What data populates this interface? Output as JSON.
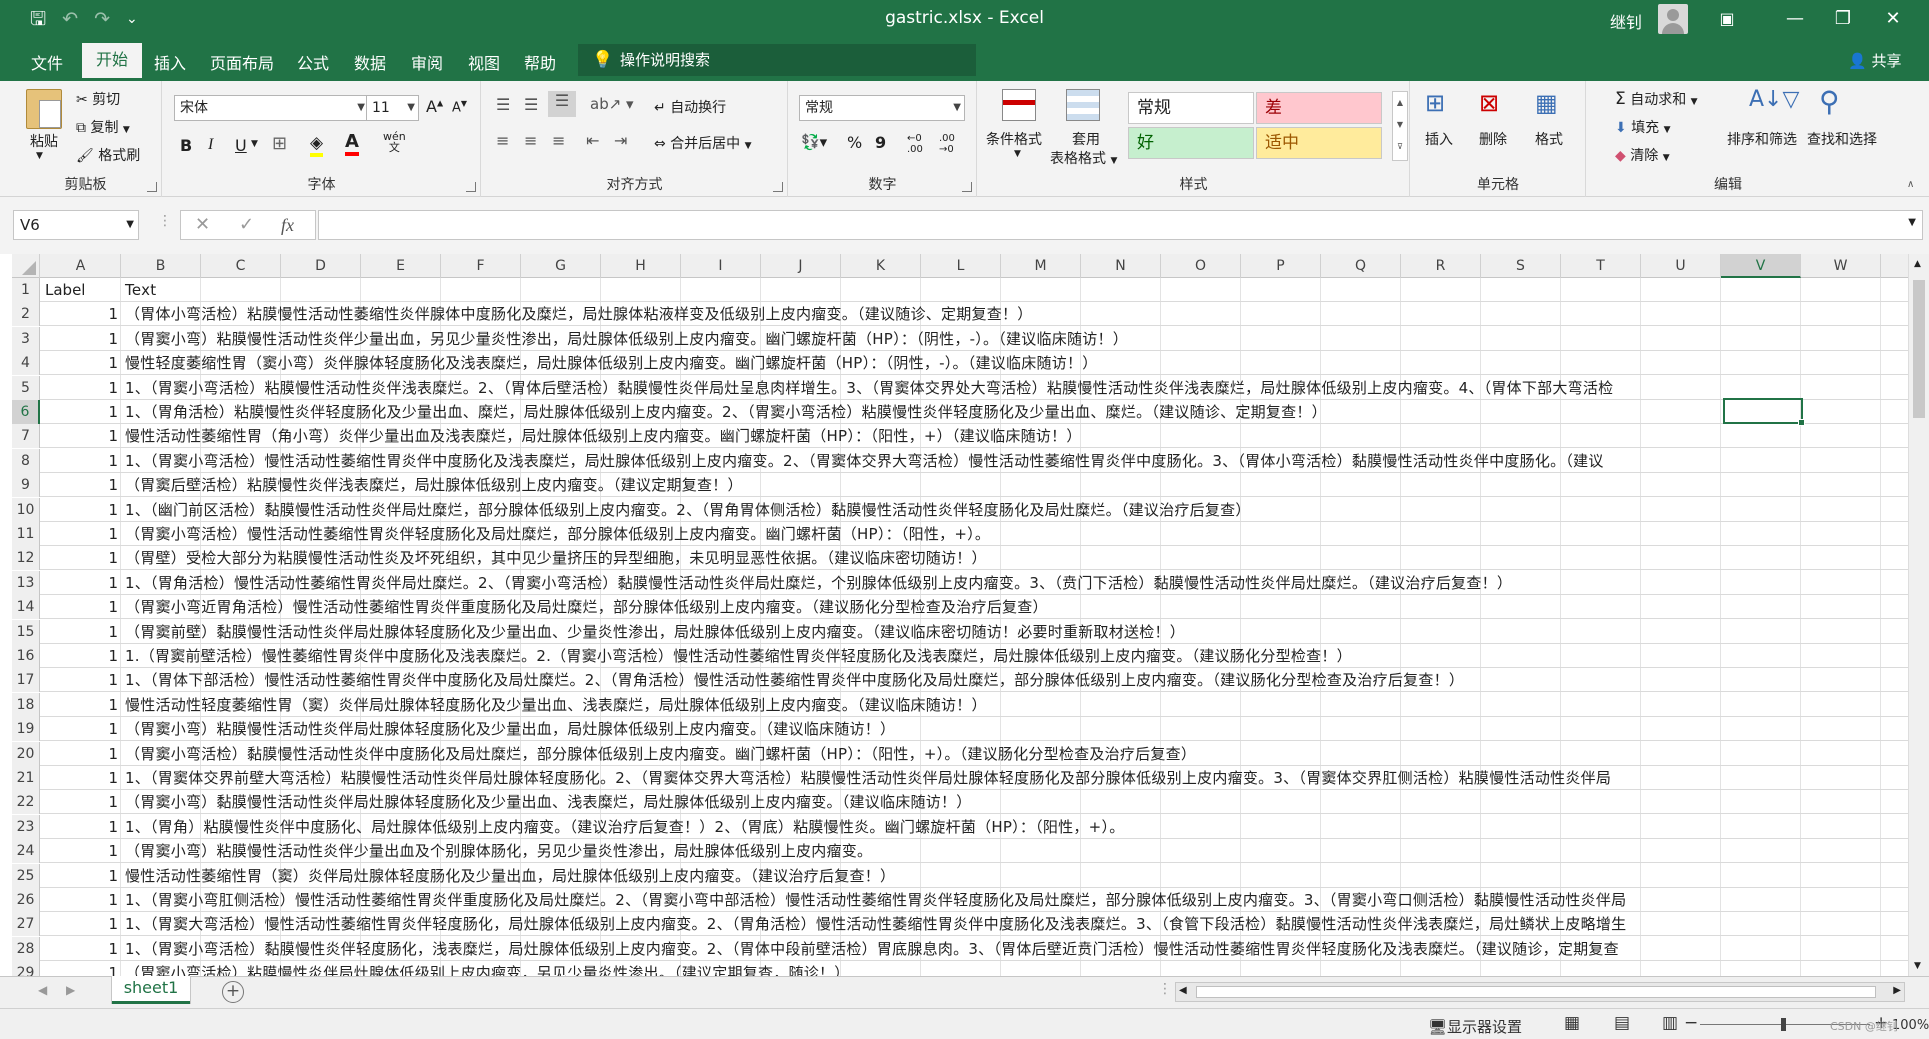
{
  "window": {
    "title": "gastric.xlsx  -  Excel",
    "user": "继钊",
    "minimize": "—",
    "maximize": "❐",
    "close": "✕",
    "ribbon_display": "▣"
  },
  "qat": {
    "save": "🖫",
    "undo": "↶",
    "redo": "↷",
    "customize": "⌄"
  },
  "menu": {
    "tabs": [
      "文件",
      "开始",
      "插入",
      "页面布局",
      "公式",
      "数据",
      "审阅",
      "视图",
      "帮助"
    ],
    "active": "开始",
    "tell_me": "操作说明搜索",
    "share": "共享"
  },
  "ribbon": {
    "clipboard": {
      "label": "剪贴板",
      "paste": "粘贴",
      "cut": "剪切",
      "copy": "复制",
      "format_painter": "格式刷"
    },
    "font": {
      "label": "字体",
      "font_name": "宋体",
      "font_size": "11",
      "bold": "B",
      "italic": "I",
      "underline": "U",
      "grow": "A",
      "shrink": "A",
      "wen": "wén"
    },
    "alignment": {
      "label": "对齐方式",
      "wrap": "自动换行",
      "merge": "合并后居中"
    },
    "number": {
      "label": "数字",
      "format": "常规",
      "percent": "%",
      "comma": "9",
      "inc": ".00",
      "dec": ".00"
    },
    "styles": {
      "label": "样式",
      "conditional": "条件格式",
      "as_table_1": "套用",
      "as_table_2": "表格格式",
      "normal": "常规",
      "bad": "差",
      "good": "好",
      "neutral": "适中"
    },
    "cells": {
      "label": "单元格",
      "insert": "插入",
      "delete": "删除",
      "format": "格式"
    },
    "editing": {
      "label": "编辑",
      "autosum": "自动求和",
      "fill": "填充",
      "clear": "清除",
      "sort_filter": "排序和筛选",
      "find_select": "查找和选择"
    },
    "colors": {
      "normal_bg": "#ffffff",
      "bad_bg": "#ffc7ce",
      "bad_fg": "#9c0006",
      "good_bg": "#c6efce",
      "good_fg": "#006100",
      "neutral_bg": "#ffeb9c",
      "neutral_fg": "#9c5700",
      "accent": "#217346"
    }
  },
  "formula_bar": {
    "name_box": "V6",
    "cancel": "✕",
    "enter": "✓",
    "fx": "fx",
    "content": ""
  },
  "columns": [
    "A",
    "B",
    "C",
    "D",
    "E",
    "F",
    "G",
    "H",
    "I",
    "J",
    "K",
    "L",
    "M",
    "N",
    "O",
    "P",
    "Q",
    "R",
    "S",
    "T",
    "U",
    "V",
    "W"
  ],
  "selected_column": "V",
  "selected_row": "6",
  "rows": [
    {
      "n": "1",
      "a": "Label",
      "b": "Text"
    },
    {
      "n": "2",
      "a": "1",
      "b": "（胃体小弯活检）粘膜慢性活动性萎缩性炎伴腺体中度肠化及糜烂，局灶腺体粘液样变及低级别上皮内瘤变。（建议随诊、定期复查！）"
    },
    {
      "n": "3",
      "a": "1",
      "b": "（胃窦小弯）粘膜慢性活动性炎伴少量出血，另见少量炎性渗出，局灶腺体低级别上皮内瘤变。幽门螺旋杆菌（HP）：（阴性，-）。（建议临床随访！）"
    },
    {
      "n": "4",
      "a": "1",
      "b": "慢性轻度萎缩性胃（窦小弯）炎伴腺体轻度肠化及浅表糜烂，局灶腺体低级别上皮内瘤变。幽门螺旋杆菌（HP）：（阴性，-）。（建议临床随访！）"
    },
    {
      "n": "5",
      "a": "1",
      "b": "1、（胃窦小弯活检）粘膜慢性活动性炎伴浅表糜烂。2、（胃体后壁活检）黏膜慢性炎伴局灶呈息肉样增生。3、（胃窦体交界处大弯活检）粘膜慢性活动性炎伴浅表糜烂，局灶腺体低级别上皮内瘤变。4、（胃体下部大弯活检"
    },
    {
      "n": "6",
      "a": "1",
      "b": "1、（胃角活检）粘膜慢性炎伴轻度肠化及少量出血、糜烂，局灶腺体低级别上皮内瘤变。2、（胃窦小弯活检）粘膜慢性炎伴轻度肠化及少量出血、糜烂。（建议随诊、定期复查！）"
    },
    {
      "n": "7",
      "a": "1",
      "b": "慢性活动性萎缩性胃（角小弯）炎伴少量出血及浅表糜烂，局灶腺体低级别上皮内瘤变。幽门螺旋杆菌（HP）：（阳性，+）（建议临床随访！）"
    },
    {
      "n": "8",
      "a": "1",
      "b": "1、（胃窦小弯活检）慢性活动性萎缩性胃炎伴中度肠化及浅表糜烂，局灶腺体低级别上皮内瘤变。2、（胃窦体交界大弯活检）慢性活动性萎缩性胃炎伴中度肠化。3、（胃体小弯活检）黏膜慢性活动性炎伴中度肠化。（建议"
    },
    {
      "n": "9",
      "a": "1",
      "b": "（胃窦后壁活检）粘膜慢性炎伴浅表糜烂，局灶腺体低级别上皮内瘤变。（建议定期复查！）"
    },
    {
      "n": "10",
      "a": "1",
      "b": "1、（幽门前区活检）黏膜慢性活动性炎伴局灶糜烂，部分腺体低级别上皮内瘤变。2、（胃角胃体侧活检）黏膜慢性活动性炎伴轻度肠化及局灶糜烂。（建议治疗后复查）"
    },
    {
      "n": "11",
      "a": "1",
      "b": "（胃窦小弯活检）慢性活动性萎缩性胃炎伴轻度肠化及局灶糜烂，部分腺体低级别上皮内瘤变。幽门螺杆菌（HP）：（阳性，+）。"
    },
    {
      "n": "12",
      "a": "1",
      "b": "（胃壁）受检大部分为粘膜慢性活动性炎及坏死组织，其中见少量挤压的异型细胞，未见明显恶性依据。（建议临床密切随访！）"
    },
    {
      "n": "13",
      "a": "1",
      "b": "1、（胃角活检）慢性活动性萎缩性胃炎伴局灶糜烂。2、（胃窦小弯活检）黏膜慢性活动性炎伴局灶糜烂，个别腺体低级别上皮内瘤变。3、（贲门下活检）黏膜慢性活动性炎伴局灶糜烂。（建议治疗后复查！）"
    },
    {
      "n": "14",
      "a": "1",
      "b": "（胃窦小弯近胃角活检）慢性活动性萎缩性胃炎伴重度肠化及局灶糜烂，部分腺体低级别上皮内瘤变。（建议肠化分型检查及治疗后复查）"
    },
    {
      "n": "15",
      "a": "1",
      "b": "（胃窦前壁）黏膜慢性活动性炎伴局灶腺体轻度肠化及少量出血、少量炎性渗出，局灶腺体低级别上皮内瘤变。（建议临床密切随访！必要时重新取材送检！）"
    },
    {
      "n": "16",
      "a": "1",
      "b": "1.（胃窦前壁活检）慢性萎缩性胃炎伴中度肠化及浅表糜烂。2.（胃窦小弯活检）慢性活动性萎缩性胃炎伴轻度肠化及浅表糜烂，局灶腺体低级别上皮内瘤变。（建议肠化分型检查！）"
    },
    {
      "n": "17",
      "a": "1",
      "b": "1、（胃体下部活检）慢性活动性萎缩性胃炎伴中度肠化及局灶糜烂。2、（胃角活检）慢性活动性萎缩性胃炎伴中度肠化及局灶糜烂，部分腺体低级别上皮内瘤变。（建议肠化分型检查及治疗后复查！）"
    },
    {
      "n": "18",
      "a": "1",
      "b": "慢性活动性轻度萎缩性胃（窦）炎伴局灶腺体轻度肠化及少量出血、浅表糜烂，局灶腺体低级别上皮内瘤变。（建议临床随访！）"
    },
    {
      "n": "19",
      "a": "1",
      "b": "（胃窦小弯）粘膜慢性活动性炎伴局灶腺体轻度肠化及少量出血，局灶腺体低级别上皮内瘤变。（建议临床随访！）"
    },
    {
      "n": "20",
      "a": "1",
      "b": "（胃窦小弯活检）黏膜慢性活动性炎伴中度肠化及局灶糜烂，部分腺体低级别上皮内瘤变。幽门螺杆菌（HP）：（阳性，+）。（建议肠化分型检查及治疗后复查）"
    },
    {
      "n": "21",
      "a": "1",
      "b": "1、（胃窦体交界前壁大弯活检）粘膜慢性活动性炎伴局灶腺体轻度肠化。2、（胃窦体交界大弯活检）粘膜慢性活动性炎伴局灶腺体轻度肠化及部分腺体低级别上皮内瘤变。3、（胃窦体交界肛侧活检）粘膜慢性活动性炎伴局"
    },
    {
      "n": "22",
      "a": "1",
      "b": "（胃窦小弯）黏膜慢性活动性炎伴局灶腺体轻度肠化及少量出血、浅表糜烂，局灶腺体低级别上皮内瘤变。（建议临床随访！）"
    },
    {
      "n": "23",
      "a": "1",
      "b": "1、（胃角）粘膜慢性炎伴中度肠化、局灶腺体低级别上皮内瘤变。（建议治疗后复查！）2、（胃底）粘膜慢性炎。幽门螺旋杆菌（HP）：（阳性，+）。"
    },
    {
      "n": "24",
      "a": "1",
      "b": "（胃窦小弯）粘膜慢性活动性炎伴少量出血及个别腺体肠化，另见少量炎性渗出，局灶腺体低级别上皮内瘤变。"
    },
    {
      "n": "25",
      "a": "1",
      "b": "慢性活动性萎缩性胃（窦）炎伴局灶腺体轻度肠化及少量出血，局灶腺体低级别上皮内瘤变。（建议治疗后复查！）"
    },
    {
      "n": "26",
      "a": "1",
      "b": "1、（胃窦小弯肛侧活检）慢性活动性萎缩性胃炎伴重度肠化及局灶糜烂。2、（胃窦小弯中部活检）慢性活动性萎缩性胃炎伴轻度肠化及局灶糜烂，部分腺体低级别上皮内瘤变。3、（胃窦小弯口侧活检）黏膜慢性活动性炎伴局"
    },
    {
      "n": "27",
      "a": "1",
      "b": "1、（胃窦大弯活检）慢性活动性萎缩性胃炎伴轻度肠化，局灶腺体低级别上皮内瘤变。2、（胃角活检）慢性活动性萎缩性胃炎伴中度肠化及浅表糜烂。3、（食管下段活检）黏膜慢性活动性炎伴浅表糜烂，局灶鳞状上皮略增生"
    },
    {
      "n": "28",
      "a": "1",
      "b": "1、（胃窦小弯活检）黏膜慢性炎伴轻度肠化，浅表糜烂，局灶腺体低级别上皮内瘤变。2、（胃体中段前壁活检）胃底腺息肉。3、（胃体后壁近贲门活检）慢性活动性萎缩性胃炎伴轻度肠化及浅表糜烂。（建议随诊，定期复查"
    },
    {
      "n": "29",
      "a": "1",
      "b": "（胃窦小弯活检）粘膜慢性炎伴局灶腺体低级别上皮内瘤变，另见少量炎性渗出。（建议定期复查，随诊！）"
    }
  ],
  "sheet": {
    "name": "sheet1",
    "add": "+"
  },
  "status": {
    "display_settings": "显示器设置",
    "zoom_minus": "−",
    "zoom_plus": "+",
    "zoom": "100%",
    "watermark": "CSDN @继钊"
  }
}
